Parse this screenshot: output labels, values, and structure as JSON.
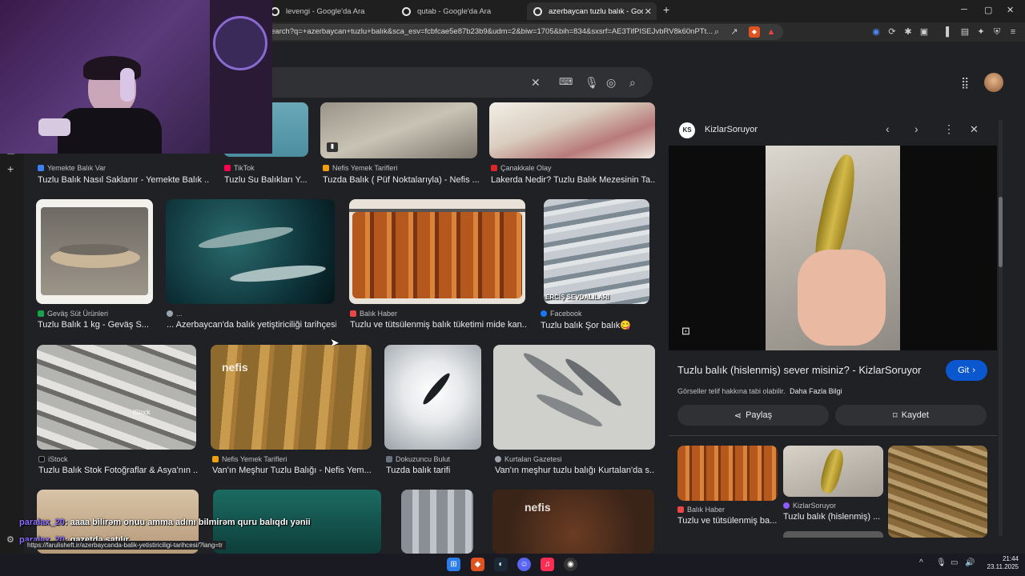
{
  "tabs": [
    {
      "title": "levengi - Google'da Ara"
    },
    {
      "title": "qutab - Google'da Ara"
    },
    {
      "title": "azerbaycan tuzlu balık - Google",
      "active": true
    }
  ],
  "new_tab_icon": "+",
  "window_controls": {
    "minimize": "─",
    "maximize": "▢",
    "close": "✕"
  },
  "address": {
    "url": "earch?q=+azerbaycan+tuzlu+balık&sca_esv=fcbfcae5e87b23b9&udm=2&biw=1705&bih=834&sxsrf=AE3TifPISEJvbRV8k60nPTt..."
  },
  "results": [
    {
      "source": "Yemekte Balık Var",
      "title": "Tuzlu Balık Nasıl Saklanır - Yemekte Balık ...",
      "icon_color": "#3b82f6"
    },
    {
      "source": "TikTok",
      "title": "Tuzlu Su Balıkları Y...",
      "icon_color": "#ff0050"
    },
    {
      "source": "Nefis Yemek Tarifleri",
      "title": "Tuzda Balık ( Püf Noktalarıyla) - Nefis ...",
      "icon_color": "#f59e0b"
    },
    {
      "source": "Çanakkale Olay",
      "title": "Lakerda Nedir? Tuzlu Balık Mezesinin Ta...",
      "icon_color": "#dc2626"
    },
    {
      "source": "Geväş Süt Ürünleri",
      "title": "Tuzlu Balık 1 kg - Geväş S...",
      "icon_color": "#16a34a"
    },
    {
      "source": "...",
      "title": "... Azerbaycan'da balık yetiştiriciliği tarihçesi",
      "icon_color": "#9ca3af"
    },
    {
      "source": "Balık Haber",
      "title": "Tuzlu ve tütsülenmiş balık tüketimi mide kan...",
      "icon_color": "#ef4444"
    },
    {
      "source": "Facebook",
      "title": "Tuzlu balık Şor balık😋",
      "icon_color": "#1877f2"
    },
    {
      "source": "iStock",
      "title": "Tuzlu Balık Stok Fotoğraflar & Asya'nın ...",
      "icon_color": "#111111"
    },
    {
      "source": "Nefis Yemek Tarifleri",
      "title": "Van'ın Meşhur Tuzlu Balığı - Nefis Yem...",
      "icon_color": "#f59e0b"
    },
    {
      "source": "Dokuzuncu Bulut",
      "title": "Tuzda balık tarifi",
      "icon_color": "#6b7280"
    },
    {
      "source": "Kurtalan Gazetesi",
      "title": "Van'ın meşhur tuzlu balığı Kurtalan'da s...",
      "icon_color": "#9ca3af"
    }
  ],
  "image_captions": {
    "nefis1": "nefis",
    "nefis2": "nefis",
    "ercis": "ERCİŞ SEVDALILARI",
    "istock": "iStock"
  },
  "panel": {
    "site": "KizlarSoruyor",
    "site_badge": "KS",
    "title": "Tuzlu balık (hislenmiş) sever misiniz? - KizlarSoruyor",
    "go_label": "Git",
    "notice": "Görseller telif hakkına tabi olabilir.",
    "more_info": "Daha Fazla Bilgi",
    "share_label": "Paylaş",
    "save_label": "Kaydet",
    "related": [
      {
        "source": "Balık Haber",
        "title": "Tuzlu ve tütsülenmiş ba..."
      },
      {
        "source": "KizlarSoruyor",
        "title": "Tuzlu balık (hislenmiş) ..."
      }
    ]
  },
  "chat": [
    {
      "user": "paralax_20",
      "message": ": aaaa bilirəm onuu amma adını bilmirəm quru balıqdı yənii"
    },
    {
      "user": "paralax_20",
      "message": ": gazetdə satılır"
    }
  ],
  "status_url": "https://farulisheft.ir/azerbaycanda-balik-yetistiriciligi-tarihcesi/?lang=tr",
  "taskbar": {
    "time": "21:44",
    "date": "23.11.2025"
  },
  "colors": {
    "accent": "#8ab4f8",
    "go_button": "#0b57d0",
    "chat_user": "#8a6cff"
  }
}
